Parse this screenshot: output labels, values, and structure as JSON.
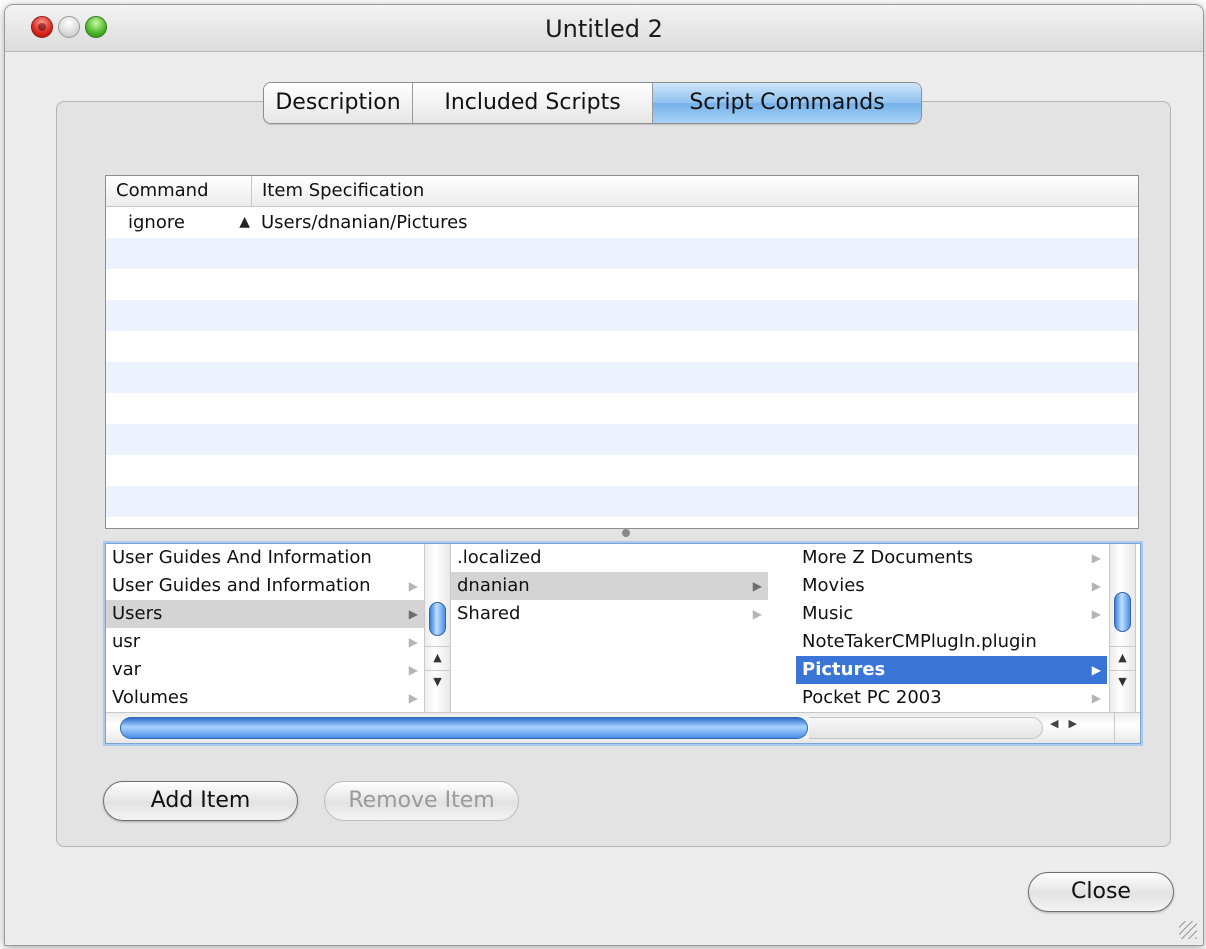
{
  "window": {
    "title": "Untitled 2"
  },
  "tabs": [
    {
      "label": "Description"
    },
    {
      "label": "Included Scripts"
    },
    {
      "label": "Script Commands"
    }
  ],
  "active_tab": "Script Commands",
  "table": {
    "columns": [
      "Command",
      "Item Specification"
    ],
    "rows": [
      {
        "command": "ignore",
        "item": "Users/dnanian/Pictures"
      }
    ]
  },
  "browser": {
    "column1": [
      {
        "label": "User Guides And Information",
        "has_children": false
      },
      {
        "label": "User Guides and Information",
        "has_children": true
      },
      {
        "label": "Users",
        "has_children": true,
        "selected": "gray"
      },
      {
        "label": "usr",
        "has_children": true
      },
      {
        "label": "var",
        "has_children": true
      },
      {
        "label": "Volumes",
        "has_children": true
      }
    ],
    "column2": [
      {
        "label": ".localized",
        "has_children": false
      },
      {
        "label": "dnanian",
        "has_children": true,
        "selected": "gray"
      },
      {
        "label": "Shared",
        "has_children": true
      }
    ],
    "column3": [
      {
        "label": "More Z Documents",
        "has_children": true
      },
      {
        "label": "Movies",
        "has_children": true
      },
      {
        "label": "Music",
        "has_children": true
      },
      {
        "label": "NoteTakerCMPlugIn.plugin",
        "has_children": false
      },
      {
        "label": "Pictures",
        "has_children": true,
        "selected": "blue"
      },
      {
        "label": "Pocket PC 2003",
        "has_children": true
      }
    ]
  },
  "buttons": {
    "add": "Add Item",
    "remove": "Remove Item",
    "close": "Close"
  },
  "colors": {
    "selection": "#3875d7",
    "inactive_selection": "#d4d4d4",
    "tab_active": "#8fc1ee",
    "row_stripe": "#edf3fe"
  }
}
